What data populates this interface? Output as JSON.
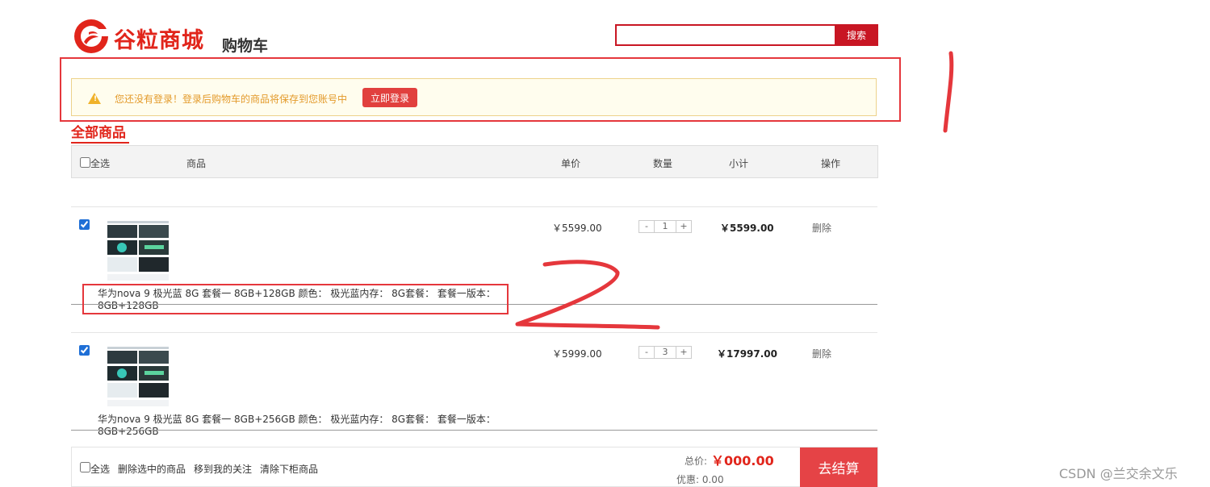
{
  "header": {
    "brand": "谷粒商城",
    "cart_title": "购物车",
    "search_value": "",
    "search_button": "搜索",
    "brand_color": "#e1251b"
  },
  "login_tip": {
    "text": "您还没有登录！登录后购物车的商品将保存到您账号中",
    "login_button": "立即登录"
  },
  "tab": {
    "label": "全部商品"
  },
  "table_header": {
    "select_all": "全选",
    "product": "商品",
    "unit_price": "单价",
    "quantity": "数量",
    "subtotal": "小计",
    "action": "操作"
  },
  "items": [
    {
      "checked": true,
      "name": "华为nova 9 极光蓝 8G 套餐一 8GB+128GB 颜色： 极光蓝内存： 8G套餐： 套餐一版本： 8GB+128GB",
      "price": "￥5599.00",
      "qty_minus": "-",
      "quantity": "1",
      "qty_plus": "+",
      "subtotal": "￥5599.00",
      "delete": "删除"
    },
    {
      "checked": true,
      "name": "华为nova 9 极光蓝 8G 套餐一 8GB+256GB 颜色： 极光蓝内存： 8G套餐： 套餐一版本： 8GB+256GB",
      "price": "￥5999.00",
      "qty_minus": "-",
      "quantity": "3",
      "qty_plus": "+",
      "subtotal": "￥17997.00",
      "delete": "删除"
    }
  ],
  "footer": {
    "select_all": "全选",
    "delete_selected": "删除选中的商品",
    "move_to_follow": "移到我的关注",
    "clear": "清除下柜商品",
    "total_label": "总价:",
    "total_value": "￥000.00",
    "discount_label": "优惠: 0.00",
    "checkout": "去结算"
  },
  "annotations": {
    "mark1": "1",
    "mark2": "2"
  },
  "watermark": "CSDN @兰交余文乐"
}
